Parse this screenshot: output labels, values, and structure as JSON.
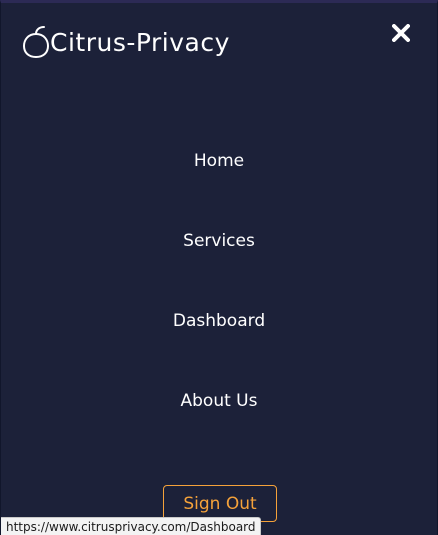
{
  "header": {
    "brand_name": "Citrus-Privacy",
    "brand_icon": "citrus-fruit-icon",
    "close_icon": "close-icon"
  },
  "nav": {
    "items": [
      {
        "label": "Home"
      },
      {
        "label": "Services"
      },
      {
        "label": "Dashboard"
      },
      {
        "label": "About Us"
      }
    ]
  },
  "auth": {
    "sign_out_label": "Sign Out"
  },
  "status_bar": {
    "url": "https://www.citrusprivacy.com/Dashboard"
  },
  "colors": {
    "background": "#1c2139",
    "text": "#ffffff",
    "accent": "#f5a23a"
  }
}
